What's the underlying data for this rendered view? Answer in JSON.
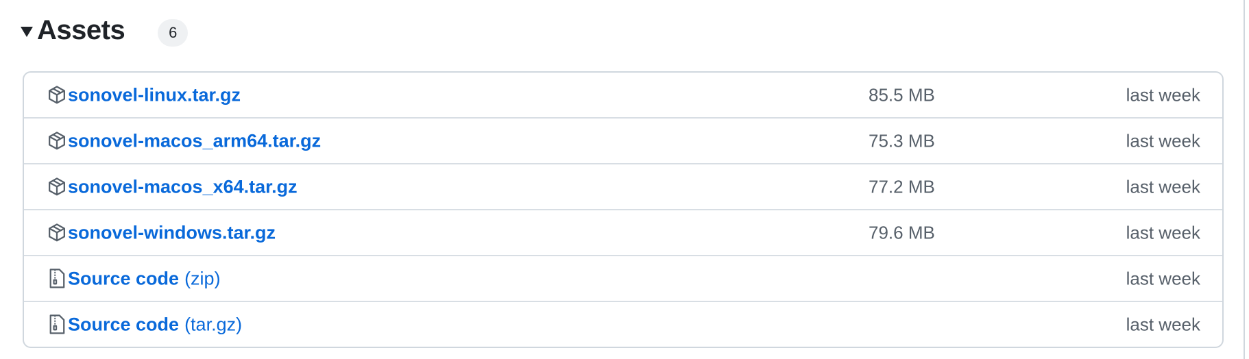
{
  "assets": {
    "title": "Assets",
    "count": "6",
    "items": [
      {
        "name": "sonovel-linux.tar.gz",
        "suffix": "",
        "size": "85.5 MB",
        "date": "last week",
        "icon": "package-icon"
      },
      {
        "name": "sonovel-macos_arm64.tar.gz",
        "suffix": "",
        "size": "75.3 MB",
        "date": "last week",
        "icon": "package-icon"
      },
      {
        "name": "sonovel-macos_x64.tar.gz",
        "suffix": "",
        "size": "77.2 MB",
        "date": "last week",
        "icon": "package-icon"
      },
      {
        "name": "sonovel-windows.tar.gz",
        "suffix": "",
        "size": "79.6 MB",
        "date": "last week",
        "icon": "package-icon"
      },
      {
        "name": "Source code",
        "suffix": "(zip)",
        "size": "",
        "date": "last week",
        "icon": "file-zip-icon"
      },
      {
        "name": "Source code",
        "suffix": "(tar.gz)",
        "size": "",
        "date": "last week",
        "icon": "file-zip-icon"
      }
    ]
  },
  "colors": {
    "link": "#0969da",
    "muted": "#57606a",
    "border": "#d0d7de",
    "counter_bg": "#eff1f3"
  }
}
